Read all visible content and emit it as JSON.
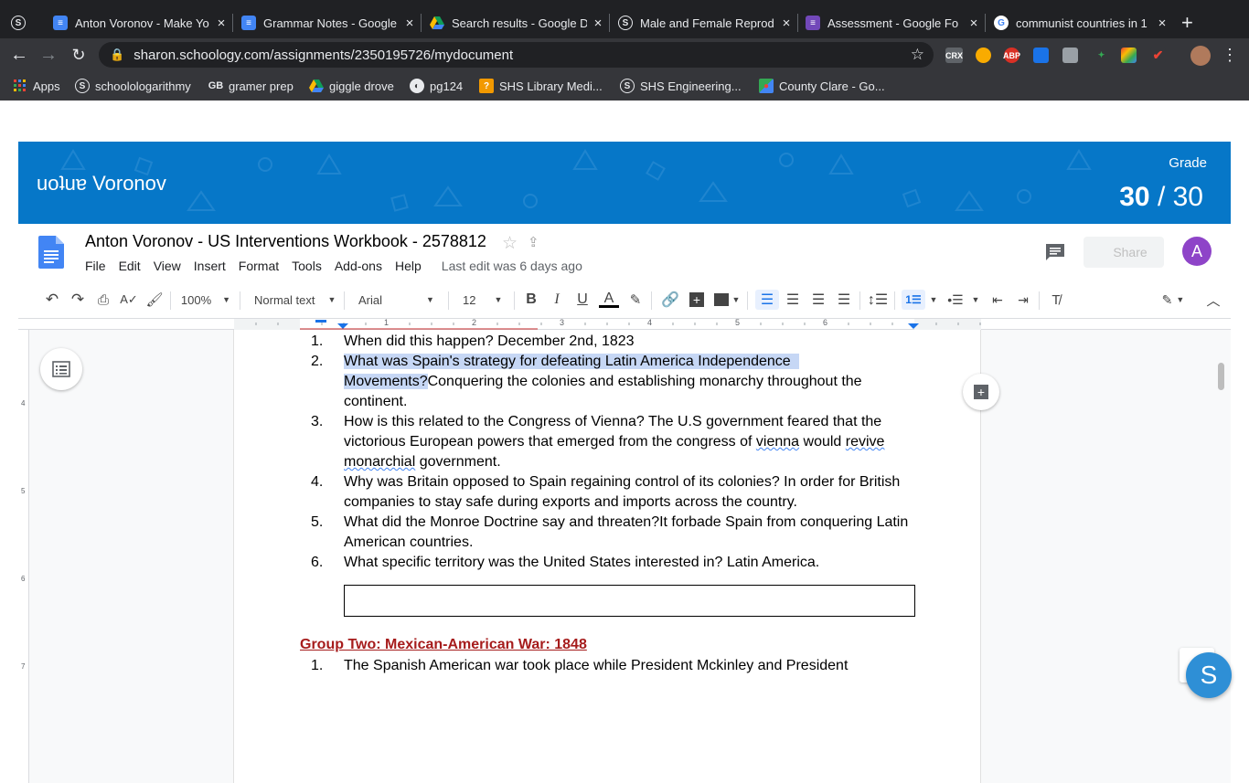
{
  "browser": {
    "tabs": [
      {
        "title": "",
        "active": false
      },
      {
        "title": "Anton Voronov - Make Yo",
        "active": false
      },
      {
        "title": "Grammar Notes - Google",
        "active": false
      },
      {
        "title": "Search results - Google D",
        "active": true
      },
      {
        "title": "Male and Female Reprod",
        "active": false
      },
      {
        "title": "Assessment - Google Fo",
        "active": false
      },
      {
        "title": "communist countries in 1",
        "active": false
      }
    ],
    "url": "sharon.schoology.com/assignments/2350195726/mydocument",
    "bookmarks": [
      {
        "label": "Apps",
        "icon": "apps-grid-icon"
      },
      {
        "label": "schoolologarithmy",
        "icon": "schoology-icon"
      },
      {
        "label": "gramer prep",
        "icon": "gb-icon"
      },
      {
        "label": "giggle drove",
        "icon": "drive-icon"
      },
      {
        "label": "pg124",
        "icon": "globe-icon"
      },
      {
        "label": "SHS Library Medi...",
        "icon": "library-icon"
      },
      {
        "label": "SHS Engineering...",
        "icon": "schoology-icon"
      },
      {
        "label": "County Clare - Go...",
        "icon": "maps-icon"
      }
    ],
    "extensions": [
      "CRX",
      "ABP"
    ]
  },
  "schoology": {
    "logo": "uoʇuɐ Voronov",
    "grade_label": "Grade",
    "grade_score": "30",
    "grade_separator": "/",
    "grade_total": "30",
    "helper_button": "S"
  },
  "doc": {
    "title": "Anton Voronov - US Interventions Workbook - 2578812",
    "menu": [
      "File",
      "Edit",
      "View",
      "Insert",
      "Format",
      "Tools",
      "Add-ons",
      "Help"
    ],
    "last_edit": "Last edit was 6 days ago",
    "share_label": "Share",
    "avatar_letter": "A",
    "toolbar": {
      "zoom": "100%",
      "style": "Normal text",
      "font": "Arial",
      "size": "12"
    },
    "ruler_labels": [
      "1",
      "2",
      "3",
      "4",
      "5",
      "6"
    ],
    "side_ruler_labels": [
      "4",
      "5",
      "6",
      "7"
    ],
    "items": [
      {
        "num": "1.",
        "lines": [
          "When did this happen? December 2nd, 1823"
        ]
      },
      {
        "num": "2.",
        "lines": [
          "What was Spain's strategy for defeating Latin America Independence",
          "Movements?Conquering the colonies and establishing monarchy throughout the",
          "continent."
        ]
      },
      {
        "num": "3.",
        "lines": [
          "How is this related to the Congress of Vienna? The U.S government feared that the",
          "victorious European powers that emerged from the congress of vienna would revive",
          "monarchial government."
        ]
      },
      {
        "num": "4.",
        "lines": [
          "Why was Britain opposed to Spain regaining control of its colonies? In order for British",
          "companies to stay safe during exports and imports across the country."
        ]
      },
      {
        "num": "5.",
        "lines": [
          "What did the Monroe Doctrine say and threaten?It forbade Spain from conquering Latin",
          "American countries."
        ]
      },
      {
        "num": "6.",
        "lines": [
          "What specific territory was the United States interested in? Latin America."
        ]
      }
    ],
    "highlight": {
      "part1": "What was Spain's strategy for defeating Latin America Independence",
      "part2": "Movements?",
      "rest2": "Conquering the colonies and establishing monarchy throughout the"
    },
    "squiggle": {
      "line3b_before": "victorious European powers that emerged from the congress of ",
      "w1": "vienna",
      "mid": " would ",
      "w2": "revive",
      "line3c_word": "monarchial",
      "line3c_rest": " government."
    },
    "section_heading": "Group Two: Mexican-American War: 1848",
    "next_item": {
      "num": "1.",
      "text": "The Spanish American war took place while President Mckinley and President"
    }
  },
  "colors": {
    "chrome_dark": "#202124",
    "chrome_toolbar": "#35363a",
    "schoology_blue": "#0677c8",
    "heading_red": "#a61c1c",
    "selection": "#c6d7f5",
    "avatar_purple": "#8e44c8"
  }
}
